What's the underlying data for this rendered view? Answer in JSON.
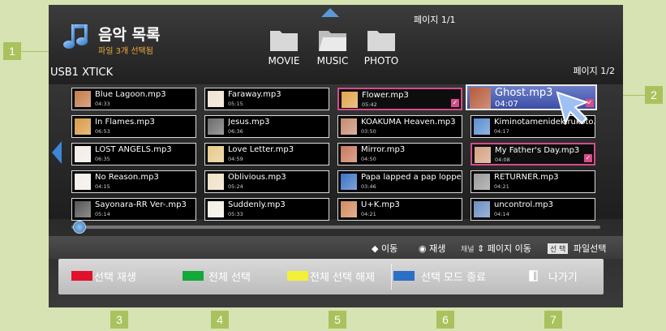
{
  "callouts": [
    "1",
    "2",
    "3",
    "4",
    "5",
    "6",
    "7"
  ],
  "header": {
    "title": "음악 목록",
    "selected_count": "파일 3개 선택됨",
    "device": "USB1 XTICK",
    "page_top": "페이지 1/1",
    "page_right": "페이지 1/2",
    "categories": [
      "MOVIE",
      "MUSIC",
      "PHOTO"
    ]
  },
  "files": [
    {
      "name": "Blue Lagoon.mp3",
      "duration": "04:33",
      "thumb": "#c47a4a",
      "selected": false
    },
    {
      "name": "Faraway.mp3",
      "duration": "05:15",
      "thumb": "#efe3d0",
      "selected": false
    },
    {
      "name": "Flower.mp3",
      "duration": "05:42",
      "thumb": "#e1a44c",
      "selected": true
    },
    {
      "name": "Ghost.mp3",
      "duration": "04:07",
      "thumb": "#b55a3a",
      "selected": true
    },
    {
      "name": "In Flames.mp3",
      "duration": "06:53",
      "thumb": "#d89a45",
      "selected": false
    },
    {
      "name": "Jesus.mp3",
      "duration": "06:36",
      "thumb": "#6b6b6b",
      "selected": false
    },
    {
      "name": "KOAKUMA Heaven.mp3",
      "duration": "03:50",
      "thumb": "#c58b6e",
      "selected": false
    },
    {
      "name": "Kiminotamenidekirukoto.m",
      "duration": "04:17",
      "thumb": "#5b8ed0",
      "selected": false
    },
    {
      "name": "LOST ANGELS.mp3",
      "duration": "06:35",
      "thumb": "#f2ece4",
      "selected": false
    },
    {
      "name": "Love Letter.mp3",
      "duration": "04:59",
      "thumb": "#e7c98a",
      "selected": false
    },
    {
      "name": "Mirror.mp3",
      "duration": "04:50",
      "thumb": "#c9785b",
      "selected": false
    },
    {
      "name": "My Father's Day.mp3",
      "duration": "04:08",
      "thumb": "#d4a080",
      "selected": true
    },
    {
      "name": "No Reason.mp3",
      "duration": "04:15",
      "thumb": "#f3eee8",
      "selected": false
    },
    {
      "name": "Oblivious.mp3",
      "duration": "05:24",
      "thumb": "#efe1c6",
      "selected": false
    },
    {
      "name": "Papa lapped a pap lopped",
      "duration": "03:46",
      "thumb": "#3d74c4",
      "selected": false
    },
    {
      "name": "RETURNER.mp3",
      "duration": "04:21",
      "thumb": "#9a9a9a",
      "selected": false
    },
    {
      "name": "Sayonara-RR Ver-.mp3",
      "duration": "05:14",
      "thumb": "#555555",
      "selected": false
    },
    {
      "name": "Suddenly.mp3",
      "duration": "05:33",
      "thumb": "#f4efe6",
      "selected": false
    },
    {
      "name": "U+K.mp3",
      "duration": "04:21",
      "thumb": "#d18a5e",
      "selected": false
    },
    {
      "name": "uncontrol.mp3",
      "duration": "04:14",
      "thumb": "#6c8dc2",
      "selected": false
    }
  ],
  "help": {
    "move": "이동",
    "play": "재생",
    "channel": "채널",
    "page_move": "페이지 이동",
    "select_key": "선 택",
    "file_select": "파일선택"
  },
  "buttons": {
    "red": "선택 재생",
    "green": "전체 선택",
    "yellow": "전체 선택 해제",
    "blue": "선택 모드 종료",
    "exit": "나가기"
  },
  "colors": {
    "red": "#e1112b",
    "green": "#14a83a",
    "yellow": "#f3f03a",
    "blue": "#2c6fc6",
    "accent": "#3d86d9",
    "selected_border": "#d44c8d"
  }
}
